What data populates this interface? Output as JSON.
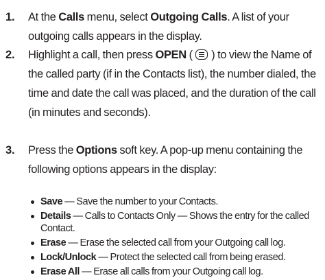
{
  "steps": [
    {
      "number": "1.",
      "t1": "At the ",
      "b1": "Calls",
      "t2": " menu, select ",
      "b2": "Outgoing Calls",
      "t3": ". A list of your outgoing calls appears in the display."
    },
    {
      "number": "2.",
      "t1": "Highlight a call, then press ",
      "b1": "OPEN",
      "t2": " ( ",
      "key_icon": "menu-ok-key-icon",
      "t3": " ) to view the Name of the called party (if in the Contacts list), the number dialed, the time and date the call was placed, and the duration of the call (in minutes and seconds)."
    },
    {
      "number": "3.",
      "t1": "Press the ",
      "b1": "Options",
      "t2": " soft key. A pop-up menu containing the following options appears in the display:"
    }
  ],
  "options": [
    {
      "name": "Save",
      "desc": " — Save the number to your Contacts."
    },
    {
      "name": "Details",
      "desc": " — Calls to Contacts Only — Shows the entry for the called Contact."
    },
    {
      "name": "Erase",
      "desc": " — Erase the selected call from your Outgoing call log."
    },
    {
      "name": "Lock/Unlock",
      "desc": " — Protect the selected call from being erased."
    },
    {
      "name": "Erase All",
      "desc": " — Erase all calls from your Outgoing call log."
    }
  ]
}
